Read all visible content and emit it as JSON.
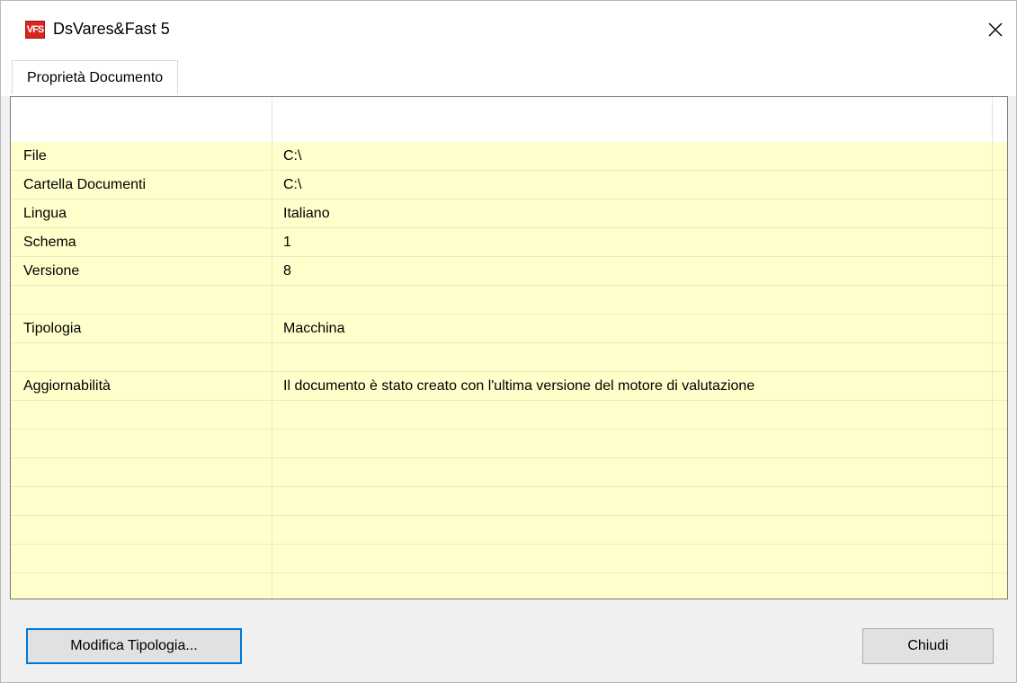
{
  "window": {
    "title": "DsVares&Fast 5",
    "icon_label": "VFS",
    "close_symbol": "close-icon"
  },
  "tabs": [
    {
      "label": "Proprietà Documento",
      "active": true
    }
  ],
  "properties": [
    {
      "label": "File",
      "value": "C:\\"
    },
    {
      "label": "Cartella Documenti",
      "value": "C:\\"
    },
    {
      "label": "Lingua",
      "value": "Italiano"
    },
    {
      "label": "Schema",
      "value": "1"
    },
    {
      "label": "Versione",
      "value": "8"
    },
    {
      "label": "",
      "value": ""
    },
    {
      "label": "Tipologia",
      "value": "Macchina"
    },
    {
      "label": "",
      "value": ""
    },
    {
      "label": "Aggiornabilità",
      "value": "Il documento è stato creato con l'ultima versione del motore di valutazione"
    },
    {
      "label": "",
      "value": ""
    },
    {
      "label": "",
      "value": ""
    },
    {
      "label": "",
      "value": ""
    },
    {
      "label": "",
      "value": ""
    },
    {
      "label": "",
      "value": ""
    },
    {
      "label": "",
      "value": ""
    },
    {
      "label": "",
      "value": ""
    }
  ],
  "buttons": {
    "modify_type": "Modifica Tipologia...",
    "close": "Chiudi"
  },
  "colors": {
    "grid_background": "#ffffcc",
    "focus_border": "#0078d7",
    "app_icon": "#d7261e"
  }
}
